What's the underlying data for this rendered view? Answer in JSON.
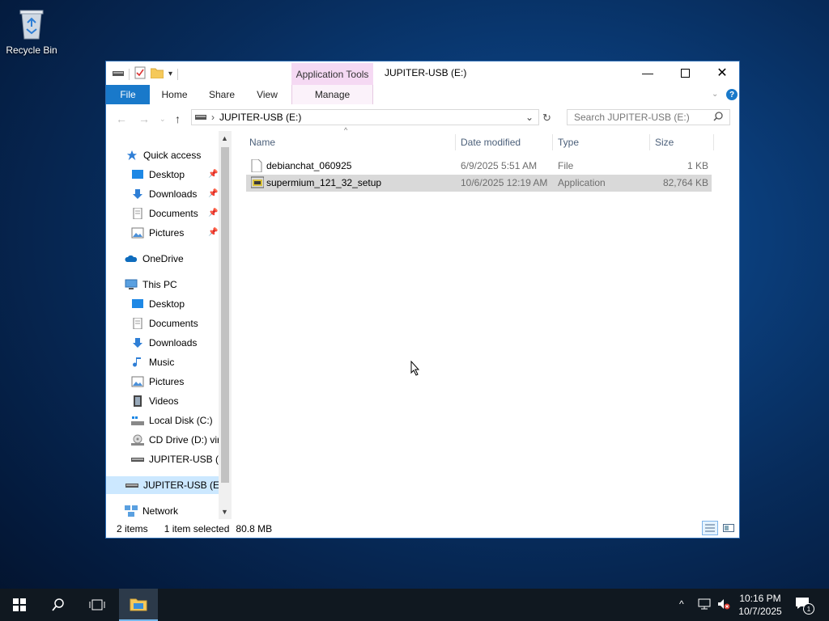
{
  "desktop": {
    "recycle_bin_label": "Recycle Bin"
  },
  "window": {
    "title": "JUPITER-USB (E:)",
    "contextual_tab_group": "Application Tools",
    "ribbon_tabs": [
      "File",
      "Home",
      "Share",
      "View",
      "Manage"
    ],
    "address_path": "JUPITER-USB (E:)",
    "search_placeholder": "Search JUPITER-USB (E:)"
  },
  "navigation": {
    "quick_access": "Quick access",
    "quick_items": [
      "Desktop",
      "Downloads",
      "Documents",
      "Pictures"
    ],
    "onedrive": "OneDrive",
    "this_pc": "This PC",
    "pc_items": [
      "Desktop",
      "Documents",
      "Downloads",
      "Music",
      "Pictures",
      "Videos",
      "Local Disk (C:)",
      "CD Drive (D:) virt",
      "JUPITER-USB (E:)"
    ],
    "selected_drive": "JUPITER-USB (E:)",
    "network": "Network"
  },
  "file_list": {
    "columns": [
      "Name",
      "Date modified",
      "Type",
      "Size"
    ],
    "rows": [
      {
        "name": "debianchat_060925",
        "date": "6/9/2025 5:51 AM",
        "type": "File",
        "size": "1 KB",
        "selected": false
      },
      {
        "name": "supermium_121_32_setup",
        "date": "10/6/2025 12:19 AM",
        "type": "Application",
        "size": "82,764 KB",
        "selected": true
      }
    ]
  },
  "status_bar": {
    "item_count": "2 items",
    "selection": "1 item selected",
    "selection_size": "80.8 MB"
  },
  "taskbar": {
    "time": "10:16 PM",
    "date": "10/7/2025",
    "notification_count": "1"
  },
  "colors": {
    "accent": "#1979ca",
    "contextual_tab": "#f5d9f3",
    "selection": "#cce8ff",
    "taskbar": "#101820"
  }
}
